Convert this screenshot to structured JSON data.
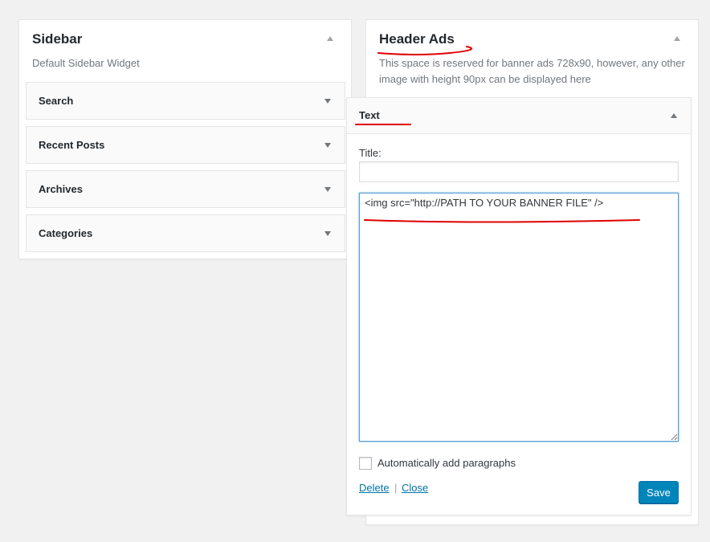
{
  "sidebar": {
    "title": "Sidebar",
    "description": "Default Sidebar Widget",
    "widgets": [
      {
        "label": "Search"
      },
      {
        "label": "Recent Posts"
      },
      {
        "label": "Archives"
      },
      {
        "label": "Categories"
      }
    ]
  },
  "header_ads": {
    "title": "Header Ads",
    "description": "This space is reserved for banner ads 728x90, however, any other image with height 90px can be displayed here",
    "text_widget": {
      "label": "Text",
      "title_field_label": "Title:",
      "title_value": "",
      "content_value": "<img src=\"http://PATH TO YOUR BANNER FILE\" />",
      "auto_paragraph_label": "Automatically add paragraphs",
      "auto_paragraph_checked": false,
      "delete_label": "Delete",
      "separator": "|",
      "close_label": "Close",
      "save_label": "Save"
    }
  },
  "colors": {
    "background": "#f1f1f1",
    "link": "#0073aa",
    "primary_button": "#0085ba",
    "annotation": "#e00000"
  }
}
